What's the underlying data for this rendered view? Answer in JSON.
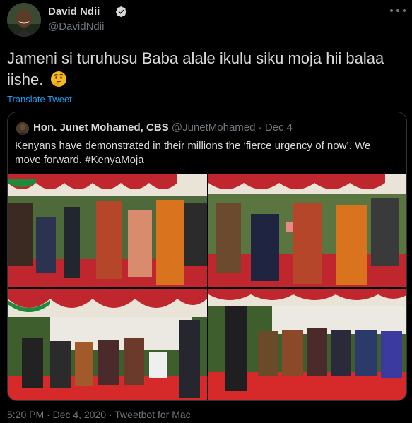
{
  "tweet": {
    "author_name": "David Ndii",
    "author_handle": "@DavidNdii",
    "verified_icon": "verified-badge-icon",
    "text": "Jameni si turuhusu Baba alale ikulu siku moja hii balaa iishe.",
    "emoji": "thinking-face-emoji",
    "translate_label": "Translate Tweet",
    "meta": "5:20 PM · Dec 4, 2020 · Tweetbot for Mac"
  },
  "quote": {
    "author_name": "Hon. Junet Mohamed, CBS",
    "author_handle": "@JunetMohamed",
    "separator": "·",
    "date": "Dec 4",
    "text": "Kenyans have demonstrated in their millions the ‘fierce urgency of now’. We move forward. #KenyaMoja"
  },
  "colors": {
    "background": "#000000",
    "text": "#d9d9d9",
    "secondary_text": "#6e767d",
    "link": "#1d9bf0",
    "border": "#2f3336"
  }
}
